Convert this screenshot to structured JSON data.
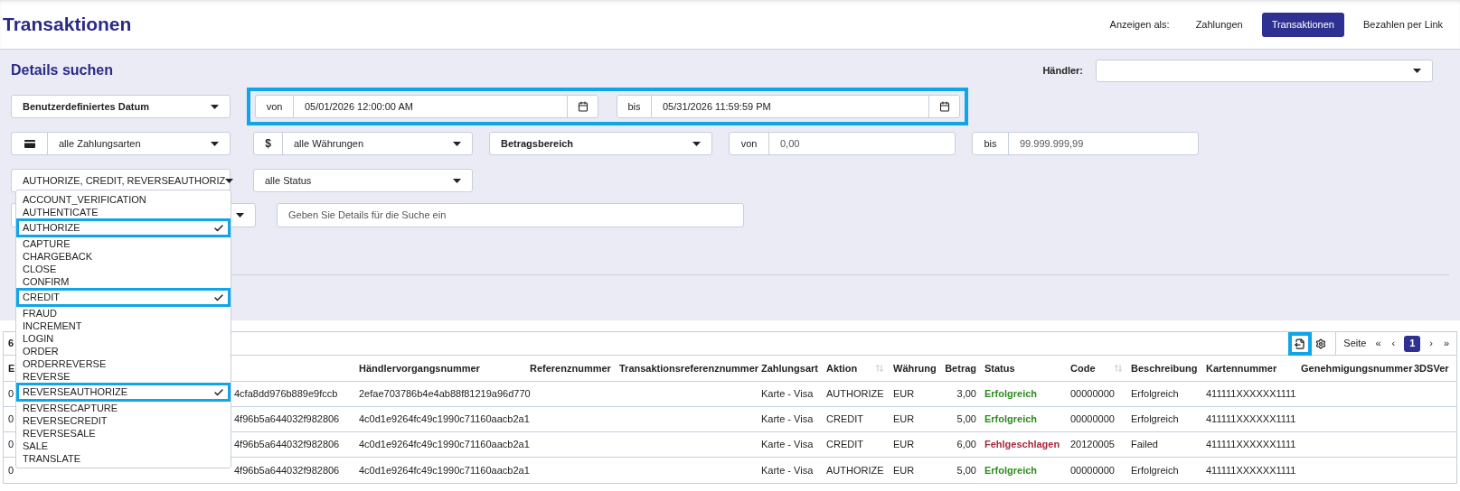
{
  "header": {
    "title": "Transaktionen",
    "view_label": "Anzeigen als:",
    "views": [
      {
        "label": "Zahlungen",
        "selected": false
      },
      {
        "label": "Transaktionen",
        "selected": true
      },
      {
        "label": "Bezahlen per Link",
        "selected": false
      }
    ]
  },
  "search": {
    "title": "Details suchen",
    "merchant_label": "Händler:",
    "date_preset": "Benutzerdefiniertes Datum",
    "date_range": {
      "highlighted": true,
      "from_label": "von",
      "from_value": "05/01/2026 12:00:00 AM",
      "to_label": "bis",
      "to_value": "05/31/2026 11:59:59 PM"
    },
    "payment_type": "alle Zahlungsarten",
    "currency_addon": "$",
    "currency": "alle Währungen",
    "amount_range": "Betragsbereich",
    "amount_from_label": "von",
    "amount_from_value": "0,00",
    "amount_to_label": "bis",
    "amount_to_value": "99.999.999,99",
    "actions_value": "AUTHORIZE, CREDIT, REVERSEAUTHORIZ",
    "status": "alle Status",
    "details_placeholder": "Geben Sie Details für die Suche ein"
  },
  "action_menu": {
    "items": [
      {
        "label": "ACCOUNT_VERIFICATION",
        "checked": false
      },
      {
        "label": "AUTHENTICATE",
        "checked": false
      },
      {
        "label": "AUTHORIZE",
        "checked": true
      },
      {
        "label": "CAPTURE",
        "checked": false
      },
      {
        "label": "CHARGEBACK",
        "checked": false
      },
      {
        "label": "CLOSE",
        "checked": false
      },
      {
        "label": "CONFIRM",
        "checked": false
      },
      {
        "label": "CREDIT",
        "checked": true
      },
      {
        "label": "FRAUD",
        "checked": false
      },
      {
        "label": "INCREMENT",
        "checked": false
      },
      {
        "label": "LOGIN",
        "checked": false
      },
      {
        "label": "ORDER",
        "checked": false
      },
      {
        "label": "ORDERREVERSE",
        "checked": false
      },
      {
        "label": "REVERSE",
        "checked": false
      },
      {
        "label": "REVERSEAUTHORIZE",
        "checked": true
      },
      {
        "label": "REVERSECAPTURE",
        "checked": false
      },
      {
        "label": "REVERSECREDIT",
        "checked": false
      },
      {
        "label": "REVERSESALE",
        "checked": false
      },
      {
        "label": "SALE",
        "checked": false
      },
      {
        "label": "TRANSLATE",
        "checked": false
      }
    ]
  },
  "table": {
    "count": "6",
    "export_highlighted": true,
    "page_label": "Seite",
    "first": "«",
    "prev": "‹",
    "next": "›",
    "last": "»",
    "pages": [
      {
        "label": "1",
        "selected": true
      }
    ],
    "columns": [
      {
        "label": "E"
      },
      {},
      {
        "label": "Händlervorgangsnummer"
      },
      {
        "label": "Referenznummer"
      },
      {
        "label": "Transaktionsreferenznummer"
      },
      {
        "label": "Zahlungsart"
      },
      {
        "label": "Aktion",
        "sortable": true
      },
      {
        "label": "Währung"
      },
      {
        "label": "Betrag"
      },
      {
        "label": "Status"
      },
      {
        "label": "Code",
        "sortable": true
      },
      {
        "label": "Beschreibung"
      },
      {
        "label": "Kartennummer"
      },
      {
        "label": "Genehmigungsnummer"
      },
      {
        "label": "3DSVer"
      }
    ],
    "rows": [
      {
        "cells": [
          "0",
          "4cfa8dd976b889e9fccb",
          "2efae703786b4e4ab88f81219a96d770",
          null,
          null,
          "Karte - Visa",
          "AUTHORIZE",
          "EUR",
          "3,00",
          {
            "text": "Erfolgreich",
            "color": "#2e8b1f"
          },
          "00000000",
          "Erfolgreich",
          "411111XXXXXX1111",
          null,
          null
        ]
      },
      {
        "cells": [
          "0",
          "4f96b5a644032f982806",
          "4c0d1e9264fc49c1990c71160aacb2a1",
          null,
          null,
          "Karte - Visa",
          "CREDIT",
          "EUR",
          "5,00",
          {
            "text": "Erfolgreich",
            "color": "#2e8b1f"
          },
          "00000000",
          "Erfolgreich",
          "411111XXXXXX1111",
          null,
          null
        ]
      },
      {
        "cells": [
          "0",
          "4f96b5a644032f982806",
          "4c0d1e9264fc49c1990c71160aacb2a1",
          null,
          null,
          "Karte - Visa",
          "CREDIT",
          "EUR",
          "6,00",
          {
            "text": "Fehlgeschlagen",
            "color": "#a8283a"
          },
          "20120005",
          "Failed",
          "411111XXXXXX1111",
          null,
          null
        ]
      },
      {
        "cells": [
          "0",
          "4f96b5a644032f982806",
          "4c0d1e9264fc49c1990c71160aacb2a1",
          null,
          null,
          "Karte - Visa",
          "AUTHORIZE",
          "EUR",
          "5,00",
          {
            "text": "Erfolgreich",
            "color": "#2e8b1f"
          },
          "00000000",
          "Erfolgreich",
          "411111XXXXXX1111",
          null,
          null
        ]
      }
    ]
  }
}
